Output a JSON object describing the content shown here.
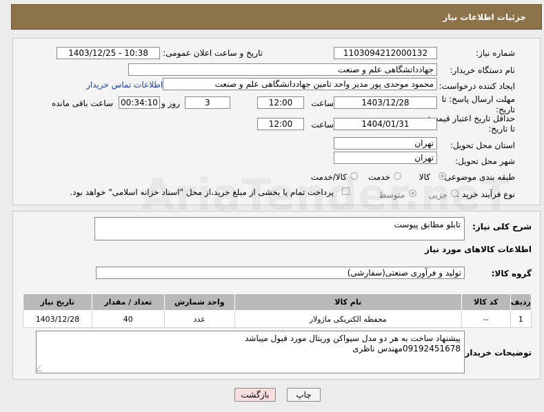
{
  "header": {
    "title": "جزئیات اطلاعات نیاز"
  },
  "need_number": {
    "label": "شماره نیاز:",
    "value": "1103094212000132"
  },
  "announce": {
    "label": "تاریخ و ساعت اعلان عمومی:",
    "value": "1403/12/25 - 10:38"
  },
  "buyer_org": {
    "label": "نام دستگاه خریدار:",
    "value": "جهاددانشگاهی علم و صنعت"
  },
  "requester": {
    "label": "ایجاد کننده درخواست:",
    "value": "محمود موحدی پور مدیر واحد تامین جهاددانشگاهی علم و صنعت",
    "contact_link": "اطلاعات تماس خریدار"
  },
  "deadline": {
    "label": "مهلت ارسال پاسخ: تا تاریخ:",
    "date": "1403/12/28",
    "time_label": "ساعت",
    "time": "12:00",
    "days": "3",
    "days_label": "روز و",
    "remaining": "00:34:10",
    "remaining_label": "ساعت باقی مانده"
  },
  "validity": {
    "label": "حداقل تاریخ اعتبار قیمت: تا تاریخ:",
    "date": "1404/01/31",
    "time_label": "ساعت",
    "time": "12:00"
  },
  "province": {
    "label": "استان محل تحویل:",
    "value": "تهران"
  },
  "city": {
    "label": "شهر محل تحویل:",
    "value": "تهران"
  },
  "category": {
    "label": "طبقه بندی موضوعی:",
    "options": [
      "کالا",
      "خدمت",
      "کالا/خدمت"
    ]
  },
  "process": {
    "label": "نوع فرآیند خرید :",
    "options": [
      "جزیی",
      "متوسط"
    ],
    "payment_note": "پرداخت تمام یا بخشی از مبلغ خرید،از محل \"اسناد خزانه اسلامی\" خواهد بود."
  },
  "description": {
    "label": "شرح کلی نیاز:",
    "value": "تابلو مطابق پیوست"
  },
  "goods_info": {
    "title": "اطلاعات کالاهای مورد نیاز"
  },
  "goods_group": {
    "label": "گروه کالا:",
    "value": "تولید و فرآوری صنعتی(سفارشی)"
  },
  "table": {
    "headers": [
      "ردیف",
      "کد کالا",
      "نام کالا",
      "واحد شمارش",
      "تعداد / مقدار",
      "تاریخ نیاز"
    ],
    "rows": [
      [
        "1",
        "--",
        "محفظه الکتریکی ماژولار",
        "عدد",
        "40",
        "1403/12/28"
      ]
    ]
  },
  "buyer_notes": {
    "label": "توضیحات خریدار:",
    "value": "پیشنهاد ساخت به هر دو مدل سیواکن وریتال مورد قبول میباشد\n09192451678مهندس ناظری"
  },
  "buttons": {
    "print": "چاپ",
    "back": "بازگشت"
  },
  "watermark": "AriaTender.neT",
  "colors": {
    "header_bg": "#8b7248",
    "link": "#1a3f9e",
    "table_header": "#b9b9b9",
    "back_button_bg": "#f8dede"
  }
}
